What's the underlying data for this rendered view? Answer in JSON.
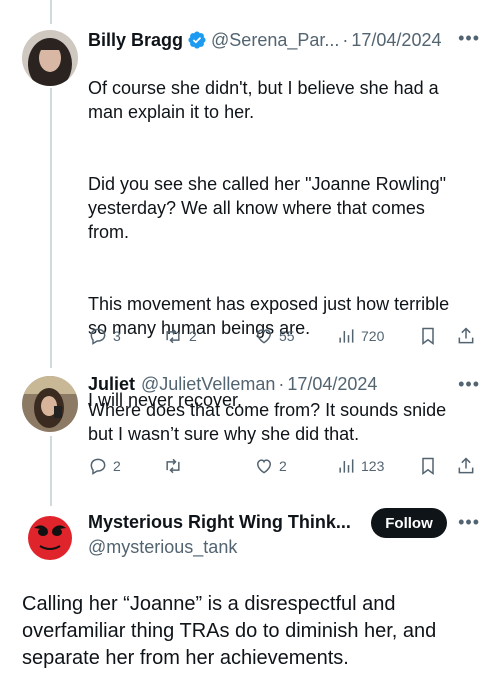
{
  "tweets": [
    {
      "name": "Billy Bragg",
      "verified": true,
      "handle": "@Serena_Par...",
      "date": "17/04/2024",
      "paragraphs": [
        "Of course she didn't, but I believe she had a\nman explain it to her.",
        "Did you see she called her \"Joanne Rowling\"\nyesterday? We all know where that comes\nfrom.",
        "This movement has exposed just how terrible\nso many human beings are.",
        "I will never recover."
      ],
      "replies": "3",
      "retweets": "2",
      "likes": "55",
      "views": "720"
    },
    {
      "name": "Juliet",
      "handle": "@JulietVelleman",
      "date": "17/04/2024",
      "text": "Where does that come from? It sounds snide\nbut I wasn’t sure why she did that.",
      "replies": "2",
      "retweets": "",
      "likes": "2",
      "views": "123"
    }
  ],
  "main_tweet": {
    "name": "Mysterious Right Wing Think...",
    "handle": "@mysterious_tank",
    "follow_label": "Follow",
    "text": "Calling her “Joanne” is a disrespectful and overfamiliar thing TRAs do to diminish her, and separate her from her achievements."
  },
  "colors": {
    "text": "#0f1419",
    "secondary": "#536471",
    "verified_blue": "#1d9bf0",
    "thread_line": "#cfd9de"
  },
  "icons": [
    "reply-icon",
    "retweet-icon",
    "like-icon",
    "views-icon",
    "bookmark-icon",
    "share-icon",
    "more-icon",
    "verified-badge-icon"
  ]
}
